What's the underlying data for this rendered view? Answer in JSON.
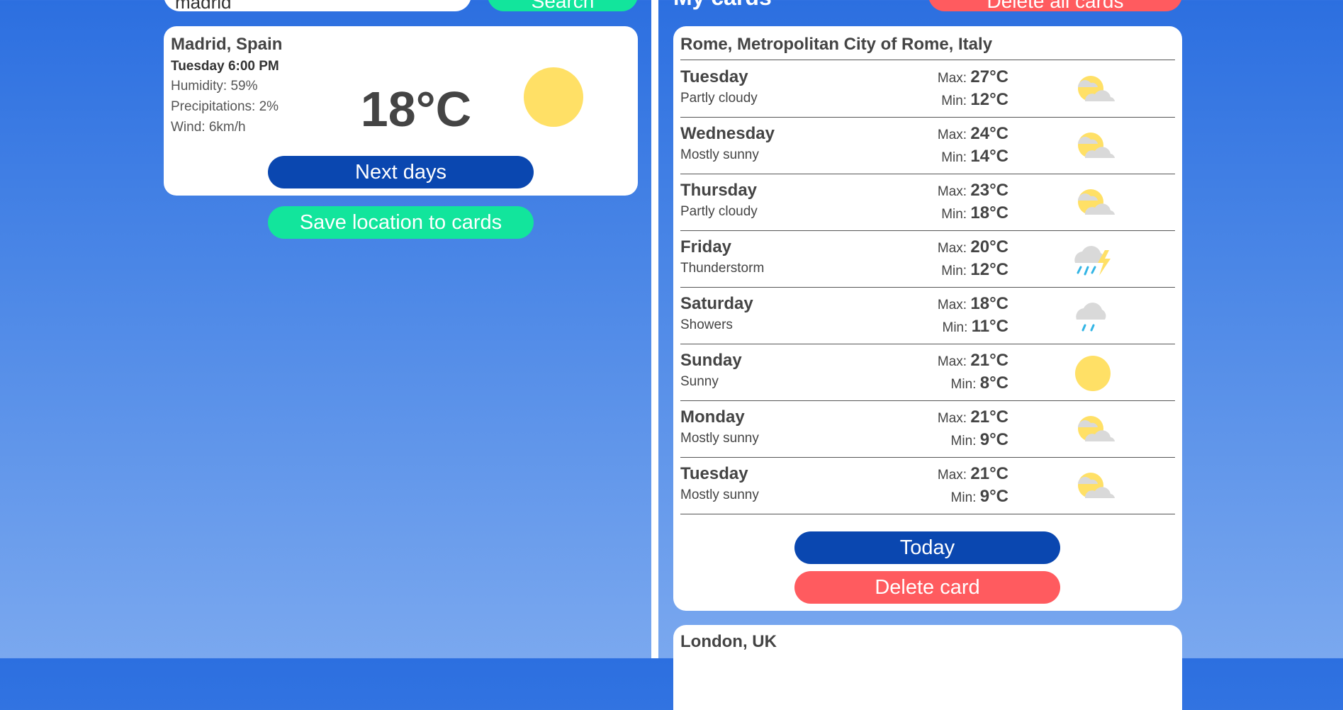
{
  "search": {
    "value": "madrid",
    "button_label": "Search"
  },
  "my_cards": {
    "title": "My cards",
    "delete_all_label": "Delete all cards"
  },
  "current": {
    "city": "Madrid, Spain",
    "datetime": "Tuesday 6:00 PM",
    "humidity": "Humidity: 59%",
    "precipitations": "Precipitations: 2%",
    "wind": "Wind: 6km/h",
    "temperature": "18°C",
    "icon": "sun-icon",
    "next_days_label": "Next days",
    "save_label": "Save location to cards"
  },
  "rome_card": {
    "city": "Rome, Metropolitan City of Rome, Italy",
    "max_prefix": "Max:",
    "min_prefix": "Min:",
    "days": [
      {
        "day": "Tuesday",
        "condition": "Partly cloudy",
        "max": "27°C",
        "min": "12°C",
        "icon": "partly-cloudy-icon"
      },
      {
        "day": "Wednesday",
        "condition": "Mostly sunny",
        "max": "24°C",
        "min": "14°C",
        "icon": "partly-cloudy-icon"
      },
      {
        "day": "Thursday",
        "condition": "Partly cloudy",
        "max": "23°C",
        "min": "18°C",
        "icon": "partly-cloudy-icon"
      },
      {
        "day": "Friday",
        "condition": "Thunderstorm",
        "max": "20°C",
        "min": "12°C",
        "icon": "thunderstorm-icon"
      },
      {
        "day": "Saturday",
        "condition": "Showers",
        "max": "18°C",
        "min": "11°C",
        "icon": "showers-icon"
      },
      {
        "day": "Sunday",
        "condition": "Sunny",
        "max": "21°C",
        "min": "8°C",
        "icon": "sun-icon"
      },
      {
        "day": "Monday",
        "condition": "Mostly sunny",
        "max": "21°C",
        "min": "9°C",
        "icon": "partly-cloudy-icon"
      },
      {
        "day": "Tuesday",
        "condition": "Mostly sunny",
        "max": "21°C",
        "min": "9°C",
        "icon": "partly-cloudy-icon"
      }
    ],
    "today_label": "Today",
    "delete_label": "Delete card"
  },
  "london_card": {
    "city": "London, UK"
  },
  "colors": {
    "accent_blue": "#0a47b0",
    "accent_green": "#12e59c",
    "accent_red": "#ff5b5f",
    "sun": "#ffe066",
    "cloud": "#d9d9d9",
    "rain": "#33b5e5"
  }
}
